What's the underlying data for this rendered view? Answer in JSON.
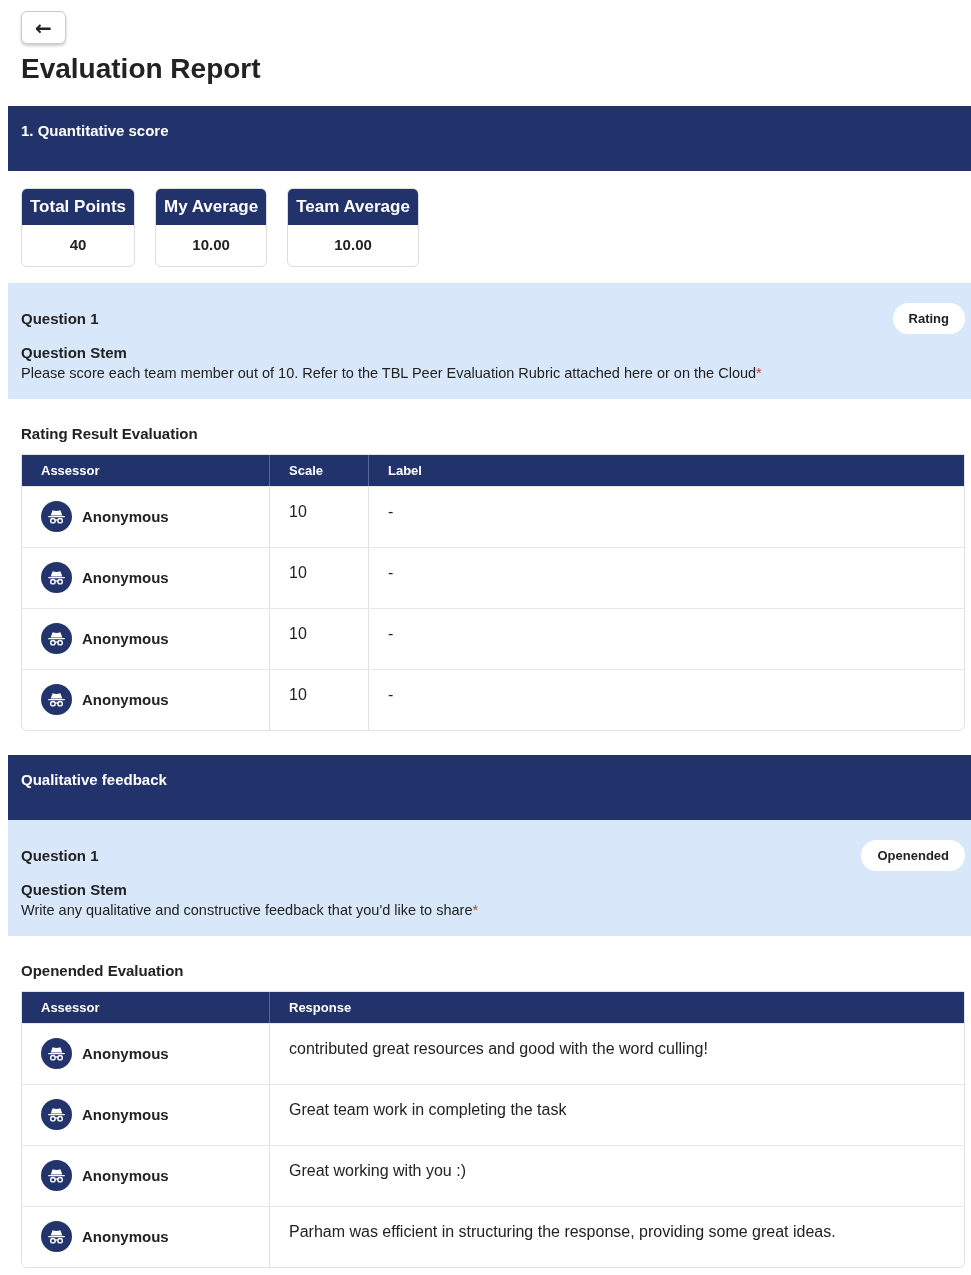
{
  "back_button": {
    "label": "←"
  },
  "title": "Evaluation Report",
  "sections": [
    {
      "heading": "1. Quantitative score",
      "stats": [
        {
          "label": "Total Points",
          "value": "40"
        },
        {
          "label": "My Average",
          "value": "10.00"
        },
        {
          "label": "Team Average",
          "value": "10.00"
        }
      ],
      "question": {
        "label": "Question 1",
        "badge": "Rating",
        "stem_label": "Question Stem",
        "stem": "Please score each team member out of 10. Refer to the TBL Peer Evaluation Rubric attached here or on the Cloud",
        "required_mark": "*"
      },
      "result_title": "Rating Result Evaluation",
      "table": {
        "columns": [
          "Assessor",
          "Scale",
          "Label"
        ],
        "rows": [
          {
            "cells": [
              "Anonymous",
              "10",
              "-"
            ]
          },
          {
            "cells": [
              "Anonymous",
              "10",
              "-"
            ]
          },
          {
            "cells": [
              "Anonymous",
              "10",
              "-"
            ]
          },
          {
            "cells": [
              "Anonymous",
              "10",
              "-"
            ]
          }
        ]
      }
    },
    {
      "heading": "Qualitative feedback",
      "question": {
        "label": "Question 1",
        "badge": "Openended",
        "stem_label": "Question Stem",
        "stem": "Write any qualitative and constructive feedback that you'd like to share",
        "required_mark": "*"
      },
      "result_title": "Openended Evaluation",
      "table": {
        "columns": [
          "Assessor",
          "Response"
        ],
        "rows": [
          {
            "cells": [
              "Anonymous",
              "contributed great resources and good with the word culling!"
            ]
          },
          {
            "cells": [
              "Anonymous",
              "Great team work in completing the task"
            ]
          },
          {
            "cells": [
              "Anonymous",
              "Great working with you :)"
            ]
          },
          {
            "cells": [
              "Anonymous",
              "Parham was efficient in structuring the response, providing some great ideas."
            ]
          }
        ]
      }
    }
  ]
}
